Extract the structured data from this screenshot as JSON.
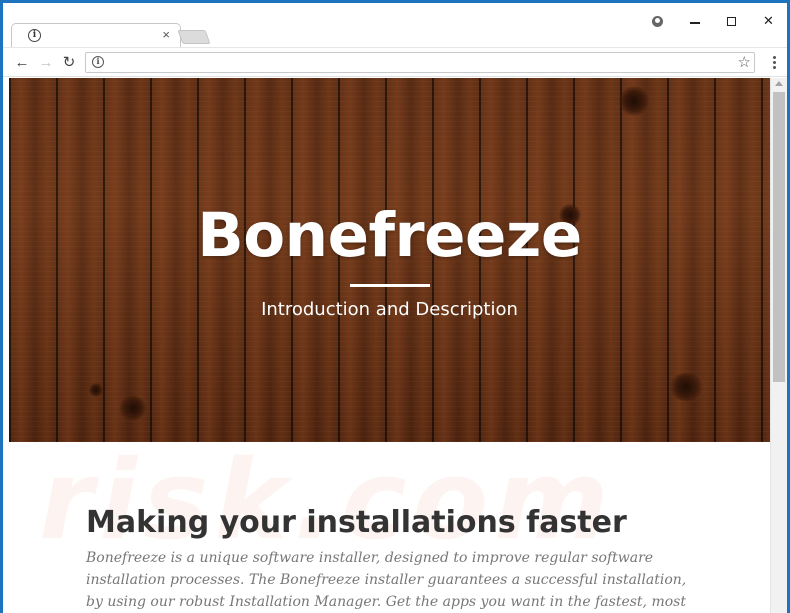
{
  "browser": {
    "tab": {
      "title": "",
      "close_glyph": "×"
    },
    "address_bar": {
      "url": ""
    },
    "window_controls": {
      "minimize_icon": "minimize-icon",
      "maximize_icon": "maximize-icon",
      "close_glyph": "✕"
    },
    "toolbar": {
      "back_glyph": "←",
      "forward_glyph": "→",
      "reload_glyph": "↻",
      "star_glyph": "☆"
    }
  },
  "hero": {
    "title": "Bonefreeze",
    "subtitle": "Introduction and Description"
  },
  "watermark": "risk.com",
  "section": {
    "heading": "Making your installations faster",
    "body": "Bonefreeze is a unique software installer, designed to improve regular software installation processes. The Bonefreeze installer guarantees a successful installation, by using our robust Installation Manager. Get the apps you want in the fastest, most convenient way."
  },
  "colors": {
    "frame_border": "#1e73be",
    "hero_wood": "#5e2f16",
    "heading": "#333333",
    "body_text": "#777777"
  }
}
